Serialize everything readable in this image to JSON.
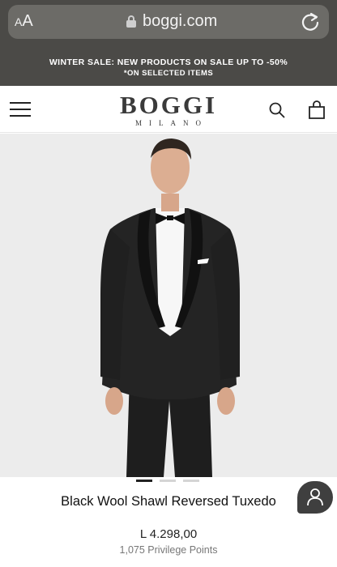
{
  "browser": {
    "text_size_label_small": "A",
    "text_size_label_large": "A",
    "url": "boggi.com"
  },
  "banner": {
    "line1": "WINTER SALE: NEW PRODUCTS ON SALE UP TO -50%",
    "line2": "*ON SELECTED ITEMS"
  },
  "header": {
    "logo_main": "BOGGI",
    "logo_sub": "MILANO"
  },
  "product": {
    "title": "Black Wool Shawl Reversed Tuxedo",
    "price": "L 4.298,00",
    "points": "1,075 Privilege Points",
    "image_count": 3,
    "active_image": 1
  },
  "icons": {
    "lock": "lock-icon",
    "reload": "reload-icon",
    "menu": "hamburger-menu-icon",
    "search": "search-icon",
    "bag": "shopping-bag-icon",
    "chat": "chat-user-icon"
  },
  "colors": {
    "browser_bar": "#4b4a47",
    "banner": "#4b4a47",
    "image_bg": "#ececec",
    "chat_button": "#3f3f3f"
  }
}
